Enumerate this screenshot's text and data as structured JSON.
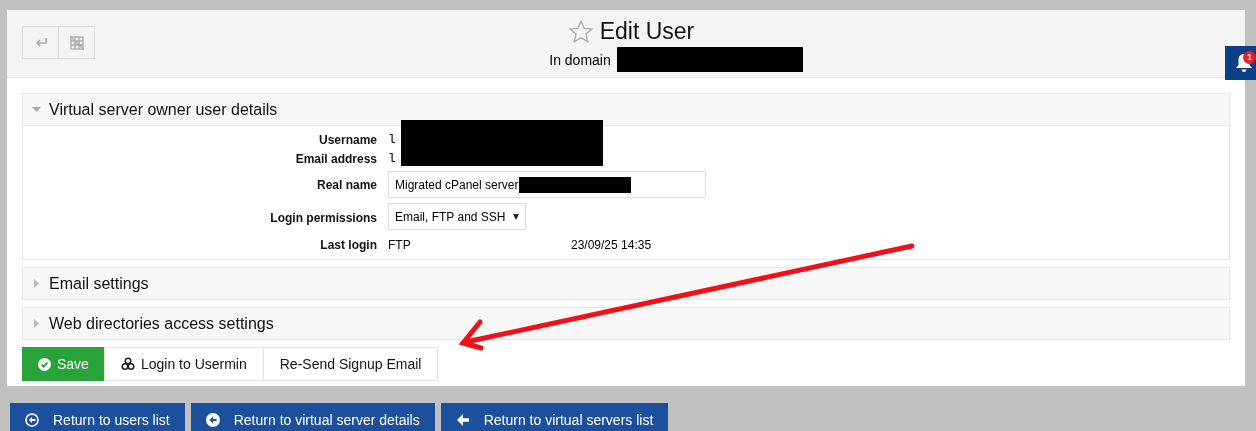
{
  "header": {
    "title": "Edit User",
    "domain_label": "In domain",
    "starred": false
  },
  "notifications": {
    "count": "1"
  },
  "sections": [
    {
      "title": "Virtual server owner user details",
      "expanded": true
    },
    {
      "title": "Email settings",
      "expanded": false
    },
    {
      "title": "Web directories access settings",
      "expanded": false
    }
  ],
  "fields": [
    {
      "kind": "text",
      "label": "Username",
      "value": "l"
    },
    {
      "kind": "text",
      "label": "Email address",
      "value": "l"
    },
    {
      "kind": "input",
      "label": "Real name",
      "value": "Migrated cPanel server"
    },
    {
      "kind": "select",
      "label": "Login permissions",
      "value": "Email, FTP and SSH"
    },
    {
      "kind": "pair",
      "label": "Last login",
      "value": "FTP",
      "time": "23/09/25 14:35"
    }
  ],
  "actions": [
    {
      "kind": "primary",
      "label": "Save"
    },
    {
      "kind": "usermin",
      "label": "Login to Usermin"
    },
    {
      "kind": "plain",
      "label": "Re-Send Signup Email"
    }
  ],
  "return_links": [
    {
      "kind": "ring",
      "label": "Return to users list"
    },
    {
      "kind": "disc",
      "label": "Return to virtual server details"
    },
    {
      "kind": "arrow",
      "label": "Return to virtual servers list"
    }
  ]
}
